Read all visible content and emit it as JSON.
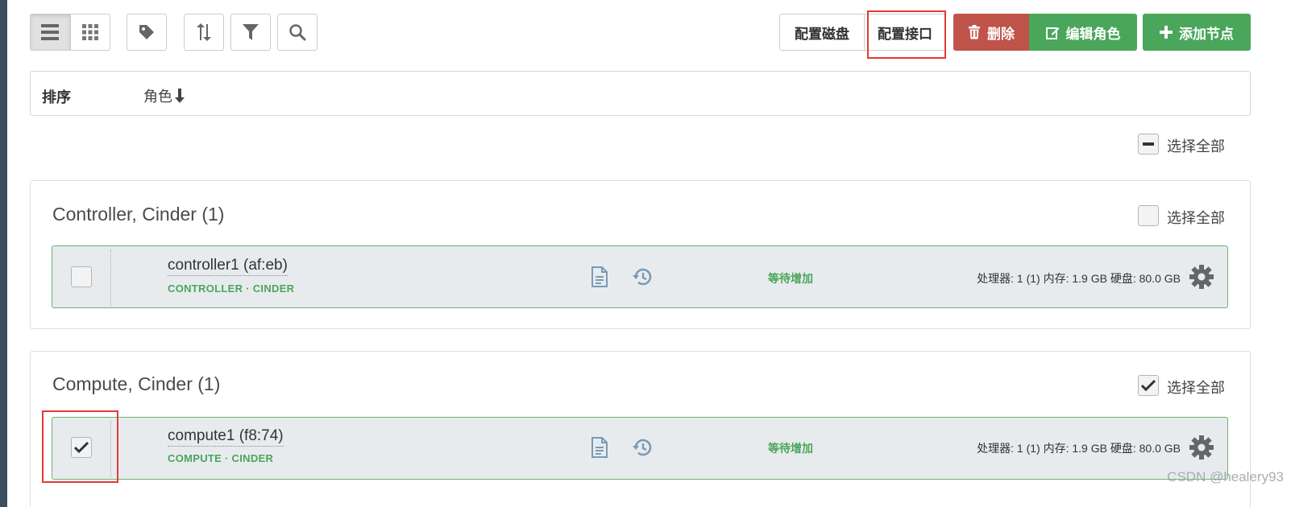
{
  "toolbar": {
    "view_list_icon": "list-icon",
    "view_grid_icon": "grid-icon",
    "tag_icon": "tag-icon",
    "sort_icon": "sort-icon",
    "filter_icon": "filter-icon",
    "search_icon": "search-icon",
    "configure_disks": "配置磁盘",
    "configure_interfaces": "配置接口",
    "delete": "删除",
    "edit_roles": "编辑角色",
    "add_nodes": "添加节点"
  },
  "sort": {
    "label": "排序",
    "role": "角色"
  },
  "select_all": {
    "label": "选择全部"
  },
  "groups": [
    {
      "title": "Controller, Cinder (1)",
      "select_all_checked": false,
      "nodes": [
        {
          "name": "controller1 (af:eb)",
          "roles": "CONTROLLER · CINDER",
          "status": "等待增加",
          "specs": "处理器: 1 (1) 内存: 1.9 GB 硬盘: 80.0 GB",
          "checked": false
        }
      ]
    },
    {
      "title": "Compute, Cinder (1)",
      "select_all_checked": true,
      "nodes": [
        {
          "name": "compute1 (f8:74)",
          "roles": "COMPUTE · CINDER",
          "status": "等待增加",
          "specs": "处理器: 1 (1) 内存: 1.9 GB 硬盘: 80.0 GB",
          "checked": true
        }
      ]
    }
  ],
  "watermark": "CSDN @healery93",
  "colors": {
    "danger": "#c0534a",
    "success": "#4aa65a",
    "highlight": "#e53935"
  }
}
